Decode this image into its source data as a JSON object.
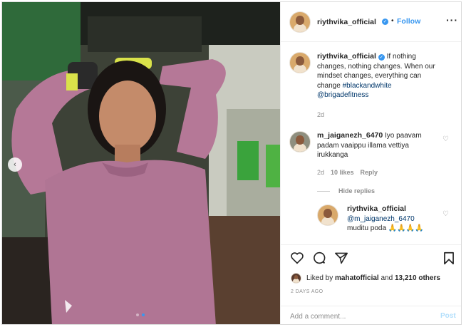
{
  "post": {
    "author": "riythvika_official",
    "follow_label": "Follow",
    "separator": "•",
    "more_icon": "more-icon",
    "photo": {
      "description_icon": "photo",
      "carousel_dots": 2,
      "active_dot": 1
    }
  },
  "caption": {
    "username": "riythvika_official",
    "text": "If nothing changes, nothing changes. When our mindset changes, everything can change",
    "hashtag": "#blackandwhite",
    "mention": "@brigadefitness",
    "time": "2d"
  },
  "comments": [
    {
      "username": "m_jaiganezh_6470",
      "text": "Iyo paavam padam vaaippu illama vettiya irukkanga",
      "time": "2d",
      "likes": "10 likes",
      "reply_label": "Reply"
    }
  ],
  "hide_replies_label": "Hide replies",
  "reply": {
    "username": "riythvika_official",
    "mention": "@m_jaiganezh_6470",
    "text": "muditu poda",
    "emoji": "🙏🙏🙏🙏"
  },
  "engagement": {
    "liked_by_prefix": "Liked by",
    "liked_by_user": "mahatofficial",
    "and_label": "and",
    "others": "13,210 others",
    "date": "2 DAYS AGO"
  },
  "add_comment": {
    "placeholder": "Add a comment...",
    "post_label": "Post"
  },
  "colors": {
    "accent": "#3897f0",
    "post_disabled": "#b2dffc",
    "muted": "#8e8e8e"
  }
}
